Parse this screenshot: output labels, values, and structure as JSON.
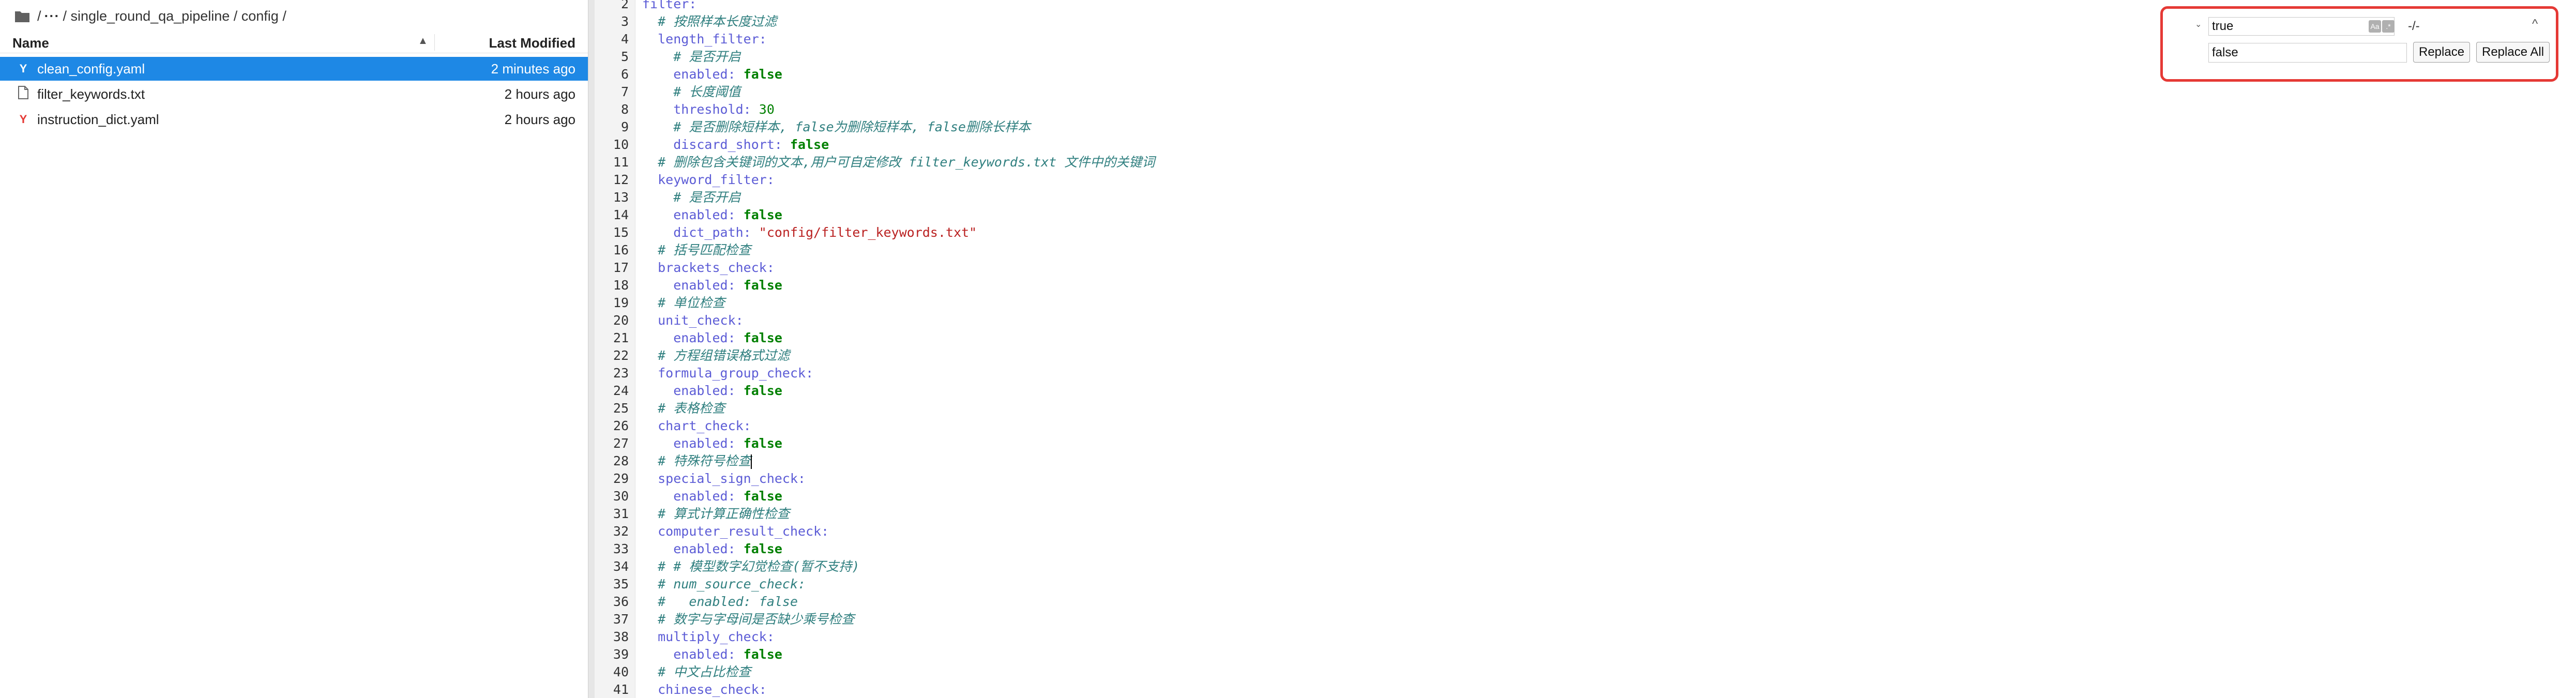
{
  "browser": {
    "breadcrumb": {
      "root": "/",
      "ellipsis": "···",
      "path": "/ single_round_qa_pipeline / config /"
    },
    "header": {
      "name": "Name",
      "sort_indicator": "▲",
      "modified": "Last Modified"
    },
    "files": [
      {
        "icon": "yaml-file-icon",
        "name": "clean_config.yaml",
        "modified": "2 minutes ago",
        "selected": true
      },
      {
        "icon": "text-file-icon",
        "name": "filter_keywords.txt",
        "modified": "2 hours ago",
        "selected": false
      },
      {
        "icon": "yaml-file-icon",
        "name": "instruction_dict.yaml",
        "modified": "2 hours ago",
        "selected": false
      }
    ]
  },
  "editor": {
    "lines": [
      {
        "n": "2",
        "toks": [
          [
            "key",
            "filter:"
          ]
        ]
      },
      {
        "n": "3",
        "toks": [
          [
            "plain",
            "  "
          ],
          [
            "comment",
            "# 按照样本长度过滤"
          ]
        ]
      },
      {
        "n": "4",
        "toks": [
          [
            "plain",
            "  "
          ],
          [
            "key",
            "length_filter:"
          ]
        ]
      },
      {
        "n": "5",
        "toks": [
          [
            "plain",
            "    "
          ],
          [
            "comment",
            "# 是否开启"
          ]
        ]
      },
      {
        "n": "6",
        "toks": [
          [
            "plain",
            "    "
          ],
          [
            "key",
            "enabled: "
          ],
          [
            "bool",
            "false"
          ]
        ]
      },
      {
        "n": "7",
        "toks": [
          [
            "plain",
            "    "
          ],
          [
            "comment",
            "# 长度阈值"
          ]
        ]
      },
      {
        "n": "8",
        "toks": [
          [
            "plain",
            "    "
          ],
          [
            "key",
            "threshold: "
          ],
          [
            "num",
            "30"
          ]
        ]
      },
      {
        "n": "9",
        "toks": [
          [
            "plain",
            "    "
          ],
          [
            "comment",
            "# 是否删除短样本, false为删除短样本, false删除长样本"
          ]
        ]
      },
      {
        "n": "10",
        "toks": [
          [
            "plain",
            "    "
          ],
          [
            "key",
            "discard_short: "
          ],
          [
            "bool",
            "false"
          ]
        ]
      },
      {
        "n": "11",
        "toks": [
          [
            "plain",
            "  "
          ],
          [
            "comment",
            "# 删除包含关键词的文本,用户可自定修改 filter_keywords.txt 文件中的关键词"
          ]
        ]
      },
      {
        "n": "12",
        "toks": [
          [
            "plain",
            "  "
          ],
          [
            "key",
            "keyword_filter:"
          ]
        ]
      },
      {
        "n": "13",
        "toks": [
          [
            "plain",
            "    "
          ],
          [
            "comment",
            "# 是否开启"
          ]
        ]
      },
      {
        "n": "14",
        "toks": [
          [
            "plain",
            "    "
          ],
          [
            "key",
            "enabled: "
          ],
          [
            "bool",
            "false"
          ]
        ]
      },
      {
        "n": "15",
        "toks": [
          [
            "plain",
            "    "
          ],
          [
            "key",
            "dict_path: "
          ],
          [
            "str",
            "\"config/filter_keywords.txt\""
          ]
        ]
      },
      {
        "n": "16",
        "toks": [
          [
            "plain",
            "  "
          ],
          [
            "comment",
            "# 括号匹配检查"
          ]
        ]
      },
      {
        "n": "17",
        "toks": [
          [
            "plain",
            "  "
          ],
          [
            "key",
            "brackets_check:"
          ]
        ]
      },
      {
        "n": "18",
        "toks": [
          [
            "plain",
            "    "
          ],
          [
            "key",
            "enabled: "
          ],
          [
            "bool",
            "false"
          ]
        ]
      },
      {
        "n": "19",
        "toks": [
          [
            "plain",
            "  "
          ],
          [
            "comment",
            "# 单位检查"
          ]
        ]
      },
      {
        "n": "20",
        "toks": [
          [
            "plain",
            "  "
          ],
          [
            "key",
            "unit_check:"
          ]
        ]
      },
      {
        "n": "21",
        "toks": [
          [
            "plain",
            "    "
          ],
          [
            "key",
            "enabled: "
          ],
          [
            "bool",
            "false"
          ]
        ]
      },
      {
        "n": "22",
        "toks": [
          [
            "plain",
            "  "
          ],
          [
            "comment",
            "# 方程组错误格式过滤"
          ]
        ]
      },
      {
        "n": "23",
        "toks": [
          [
            "plain",
            "  "
          ],
          [
            "key",
            "formula_group_check:"
          ]
        ]
      },
      {
        "n": "24",
        "toks": [
          [
            "plain",
            "    "
          ],
          [
            "key",
            "enabled: "
          ],
          [
            "bool",
            "false"
          ]
        ]
      },
      {
        "n": "25",
        "toks": [
          [
            "plain",
            "  "
          ],
          [
            "comment",
            "# 表格检查"
          ]
        ]
      },
      {
        "n": "26",
        "toks": [
          [
            "plain",
            "  "
          ],
          [
            "key",
            "chart_check:"
          ]
        ]
      },
      {
        "n": "27",
        "toks": [
          [
            "plain",
            "    "
          ],
          [
            "key",
            "enabled: "
          ],
          [
            "bool",
            "false"
          ]
        ]
      },
      {
        "n": "28",
        "toks": [
          [
            "plain",
            "  "
          ],
          [
            "comment",
            "# 特殊符号检查"
          ]
        ],
        "cursor": true
      },
      {
        "n": "29",
        "toks": [
          [
            "plain",
            "  "
          ],
          [
            "key",
            "special_sign_check:"
          ]
        ]
      },
      {
        "n": "30",
        "toks": [
          [
            "plain",
            "    "
          ],
          [
            "key",
            "enabled: "
          ],
          [
            "bool",
            "false"
          ]
        ]
      },
      {
        "n": "31",
        "toks": [
          [
            "plain",
            "  "
          ],
          [
            "comment",
            "# 算式计算正确性检查"
          ]
        ]
      },
      {
        "n": "32",
        "toks": [
          [
            "plain",
            "  "
          ],
          [
            "key",
            "computer_result_check:"
          ]
        ]
      },
      {
        "n": "33",
        "toks": [
          [
            "plain",
            "    "
          ],
          [
            "key",
            "enabled: "
          ],
          [
            "bool",
            "false"
          ]
        ]
      },
      {
        "n": "34",
        "toks": [
          [
            "plain",
            "  "
          ],
          [
            "comment",
            "# # 模型数字幻觉检查(暂不支持)"
          ]
        ]
      },
      {
        "n": "35",
        "toks": [
          [
            "plain",
            "  "
          ],
          [
            "comment",
            "# num_source_check:"
          ]
        ]
      },
      {
        "n": "36",
        "toks": [
          [
            "plain",
            "  "
          ],
          [
            "comment",
            "#   enabled: false"
          ]
        ]
      },
      {
        "n": "37",
        "toks": [
          [
            "plain",
            "  "
          ],
          [
            "comment",
            "# 数字与字母间是否缺少乘号检查"
          ]
        ]
      },
      {
        "n": "38",
        "toks": [
          [
            "plain",
            "  "
          ],
          [
            "key",
            "multiply_check:"
          ]
        ]
      },
      {
        "n": "39",
        "toks": [
          [
            "plain",
            "    "
          ],
          [
            "key",
            "enabled: "
          ],
          [
            "bool",
            "false"
          ]
        ]
      },
      {
        "n": "40",
        "toks": [
          [
            "plain",
            "  "
          ],
          [
            "comment",
            "# 中文占比检查"
          ]
        ]
      },
      {
        "n": "41",
        "toks": [
          [
            "plain",
            "  "
          ],
          [
            "key",
            "chinese_check:"
          ]
        ]
      }
    ]
  },
  "find_replace": {
    "toggle_glyph": "⌄",
    "find_value": "true",
    "option_case": "Aa",
    "option_regex": ".*",
    "match_count": "-/-",
    "prev_glyph": "^",
    "replace_value": "false",
    "replace_label": "Replace",
    "replace_all_label": "Replace All",
    "highlight_color": "#e53935"
  }
}
